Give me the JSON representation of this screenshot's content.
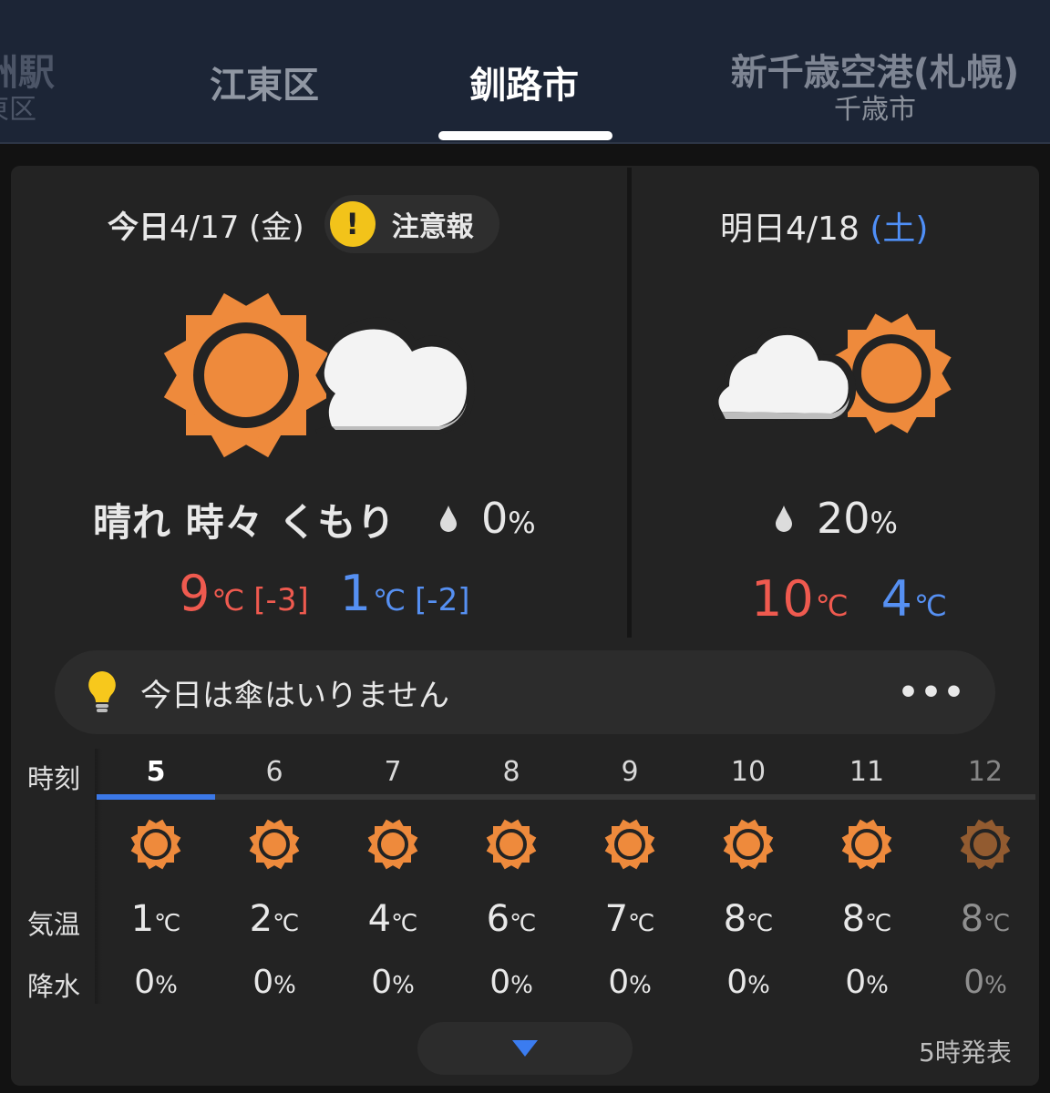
{
  "tabs": [
    {
      "name": "洲駅",
      "sub": "東区"
    },
    {
      "name": "江東区",
      "sub": ""
    },
    {
      "name": "釧路市",
      "sub": "",
      "active": true
    },
    {
      "name": "新千歳空港(札幌)",
      "sub": "千歳市"
    }
  ],
  "today": {
    "label": "今日",
    "date": "4/17",
    "weekday": "(金)",
    "alert_icon": "!",
    "alert_label": "注意報",
    "icon": "sun-then-cloud-icon",
    "weather": "晴れ 時々 くもり",
    "rain_value": "0",
    "rain_unit": "%",
    "high": "9",
    "high_diff": "[-3]",
    "low": "1",
    "low_diff": "[-2]",
    "temp_unit": "℃"
  },
  "tomorrow": {
    "label": "明日",
    "date": "4/18",
    "weekday_open": "(",
    "weekday": "土",
    "weekday_close": ")",
    "icon": "cloud-then-sun-icon",
    "rain_value": "20",
    "rain_unit": "%",
    "high": "10",
    "low": "4",
    "temp_unit": "℃"
  },
  "advice": {
    "icon": "lightbulb-icon",
    "text": "今日は傘はいりません",
    "more": "•••"
  },
  "hourly": {
    "time_label": "時刻",
    "temp_label": "気温",
    "rain_label": "降水",
    "temp_unit": "℃",
    "rain_unit": "%",
    "hours": [
      {
        "hour": "5",
        "temp": "1",
        "rain": "0"
      },
      {
        "hour": "6",
        "temp": "2",
        "rain": "0"
      },
      {
        "hour": "7",
        "temp": "4",
        "rain": "0"
      },
      {
        "hour": "8",
        "temp": "6",
        "rain": "0"
      },
      {
        "hour": "9",
        "temp": "7",
        "rain": "0"
      },
      {
        "hour": "10",
        "temp": "8",
        "rain": "0"
      },
      {
        "hour": "11",
        "temp": "8",
        "rain": "0"
      },
      {
        "hour": "12",
        "temp": "8",
        "rain": "0"
      }
    ]
  },
  "footer": {
    "issued": "5時発表"
  },
  "colors": {
    "header_bg": "#1c2536",
    "sun_orange": "#ee8a3c",
    "high_red": "#ef5a4f",
    "low_blue": "#5690f2",
    "active_blue": "#3b78e7",
    "alert_yellow": "#f2c31a"
  }
}
